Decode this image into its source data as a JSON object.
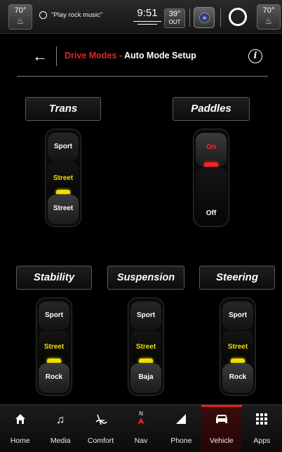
{
  "status_bar": {
    "left_temp": "70°",
    "voice_prompt": "\"Play rock music\"",
    "time": "9:51",
    "outside_temp": "39°",
    "outside_label": "OUT",
    "right_temp": "70°"
  },
  "header": {
    "title_section": "Drive Modes",
    "title_separator": " - ",
    "title_page": "Auto Mode Setup",
    "info_glyph": "i",
    "back_glyph": "←"
  },
  "settings": {
    "trans": {
      "label": "Trans",
      "options": [
        "Sport",
        "Street",
        "Street"
      ],
      "selected": "Street"
    },
    "paddles": {
      "label": "Paddles",
      "options": [
        "On",
        "Off"
      ],
      "selected": "On"
    },
    "stability": {
      "label": "Stability",
      "options": [
        "Sport",
        "Street",
        "Rock"
      ],
      "selected": "Street"
    },
    "suspension": {
      "label": "Suspension",
      "options": [
        "Sport",
        "Street",
        "Baja"
      ],
      "selected": "Street"
    },
    "steering": {
      "label": "Steering",
      "options": [
        "Sport",
        "Street",
        "Rock"
      ],
      "selected": "Street"
    }
  },
  "nav": {
    "items": [
      {
        "label": "Home",
        "icon": "home-icon"
      },
      {
        "label": "Media",
        "icon": "music-note-icon"
      },
      {
        "label": "Comfort",
        "icon": "seat-icon"
      },
      {
        "label": "Nav",
        "icon": "compass-icon",
        "glyph": "N"
      },
      {
        "label": "Phone",
        "icon": "signal-icon"
      },
      {
        "label": "Vehicle",
        "icon": "car-icon",
        "active": true
      },
      {
        "label": "Apps",
        "icon": "grid-icon"
      }
    ]
  },
  "colors": {
    "accent_red": "#e02424",
    "selected_yellow": "#f2de00",
    "paddles_on_red": "#ff2a2a"
  }
}
